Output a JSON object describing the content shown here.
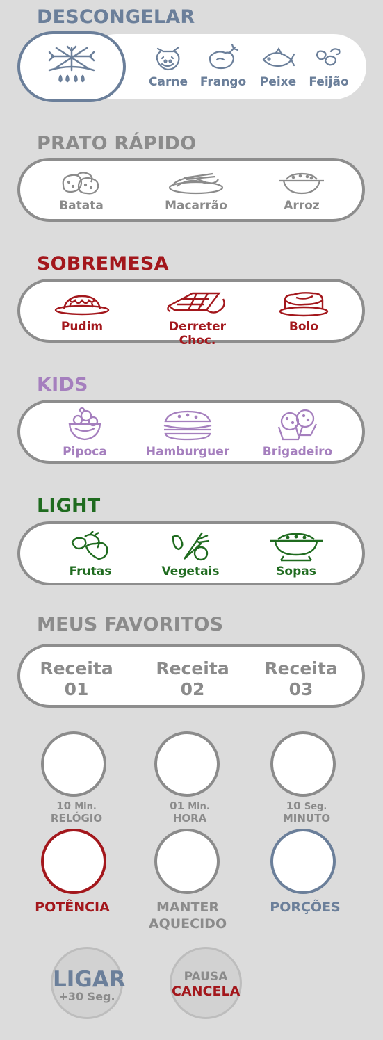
{
  "colors": {
    "background": "#dcdcdc",
    "blue_gray": "#6b7f9a",
    "gray": "#8b8b8b",
    "red": "#a3171c",
    "purple": "#a57fbe",
    "green": "#1f6b1f"
  },
  "descongelar": {
    "title": "DESCONGELAR",
    "main_icon": "snowflake-thaw-icon",
    "items": [
      {
        "label": "Carne",
        "icon": "cow-icon"
      },
      {
        "label": "Frango",
        "icon": "chicken-icon"
      },
      {
        "label": "Peixe",
        "icon": "fish-icon"
      },
      {
        "label": "Feijão",
        "icon": "beans-icon"
      }
    ]
  },
  "prato_rapido": {
    "title": "PRATO RÁPIDO",
    "items": [
      {
        "label": "Batata",
        "icon": "potato-icon"
      },
      {
        "label": "Macarrão",
        "icon": "pasta-icon"
      },
      {
        "label": "Arroz",
        "icon": "rice-bowl-icon"
      }
    ]
  },
  "sobremesa": {
    "title": "SOBREMESA",
    "items": [
      {
        "label": "Pudim",
        "icon": "pudding-icon"
      },
      {
        "label": "Derreter Choc.",
        "icon": "chocolate-icon"
      },
      {
        "label": "Bolo",
        "icon": "cake-icon"
      }
    ]
  },
  "kids": {
    "title": "KIDS",
    "items": [
      {
        "label": "Pipoca",
        "icon": "popcorn-icon"
      },
      {
        "label": "Hamburguer",
        "icon": "hamburger-icon"
      },
      {
        "label": "Brigadeiro",
        "icon": "brigadeiro-icon"
      }
    ]
  },
  "light": {
    "title": "LIGHT",
    "items": [
      {
        "label": "Frutas",
        "icon": "fruits-icon"
      },
      {
        "label": "Vegetais",
        "icon": "vegetables-icon"
      },
      {
        "label": "Sopas",
        "icon": "soup-pot-icon"
      }
    ]
  },
  "favoritos": {
    "title": "MEUS FAVORITOS",
    "items": [
      {
        "line1": "Receita",
        "line2": "01"
      },
      {
        "line1": "Receita",
        "line2": "02"
      },
      {
        "line1": "Receita",
        "line2": "03"
      }
    ]
  },
  "time_buttons": [
    {
      "line1_num": "10",
      "line1_unit": "Min.",
      "line2": "RELÓGIO"
    },
    {
      "line1_num": "01",
      "line1_unit": "Min.",
      "line2": "HORA"
    },
    {
      "line1_num": "10",
      "line1_unit": "Seg.",
      "line2": "MINUTO"
    }
  ],
  "function_buttons": [
    {
      "line1": "POTÊNCIA",
      "line2": ""
    },
    {
      "line1": "MANTER",
      "line2": "AQUECIDO"
    },
    {
      "line1": "PORÇÕES",
      "line2": ""
    }
  ],
  "start_button": {
    "line1": "LIGAR",
    "line2": "+30 Seg."
  },
  "stop_button": {
    "line1": "PAUSA",
    "line2": "CANCELA"
  }
}
